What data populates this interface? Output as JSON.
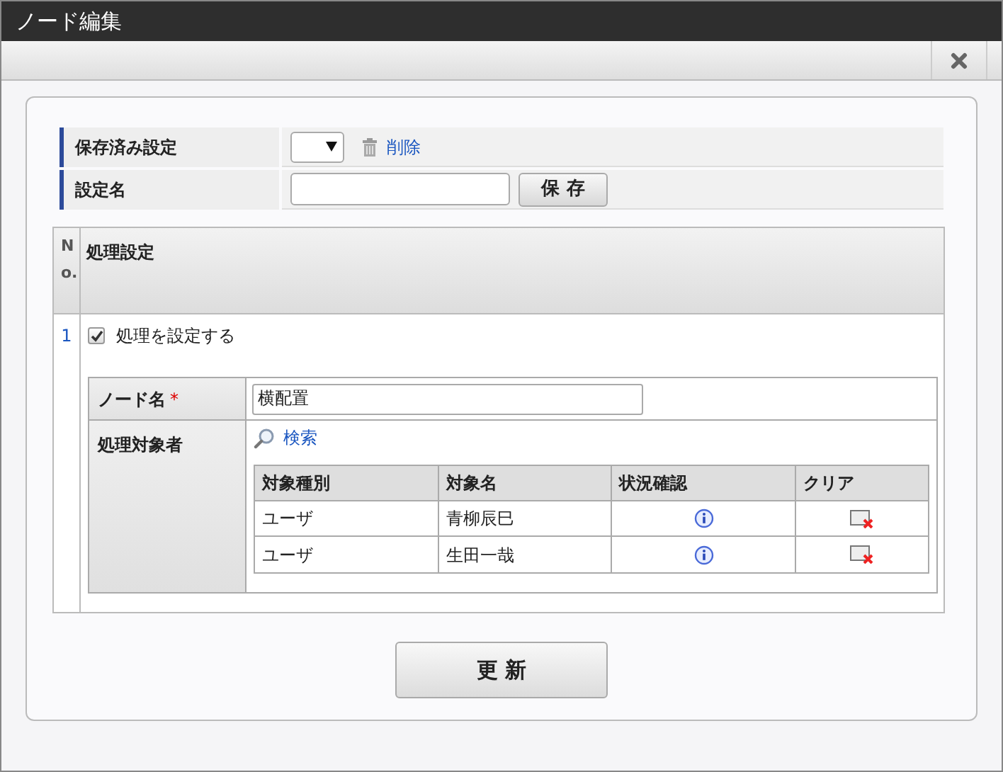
{
  "window": {
    "title": "ノード編集"
  },
  "saved_settings": {
    "label": "保存済み設定",
    "delete_link": "削除"
  },
  "setting_name": {
    "label": "設定名",
    "save_button": "保 存"
  },
  "process_table": {
    "columns": [
      "No.",
      "処理設定"
    ],
    "rows": [
      {
        "no": "1",
        "enable": {
          "label": "処理を設定する",
          "checked": true
        },
        "node_name": {
          "label": "ノード名",
          "required_mark": "*",
          "value": "横配置"
        },
        "targets": {
          "label": "処理対象者",
          "search_link": "検索",
          "columns": [
            "対象種別",
            "対象名",
            "状況確認",
            "クリア"
          ],
          "rows": [
            {
              "type": "ユーザ",
              "name": "青柳辰巳"
            },
            {
              "type": "ユーザ",
              "name": "生田一哉"
            }
          ]
        }
      }
    ]
  },
  "update_button": "更 新"
}
